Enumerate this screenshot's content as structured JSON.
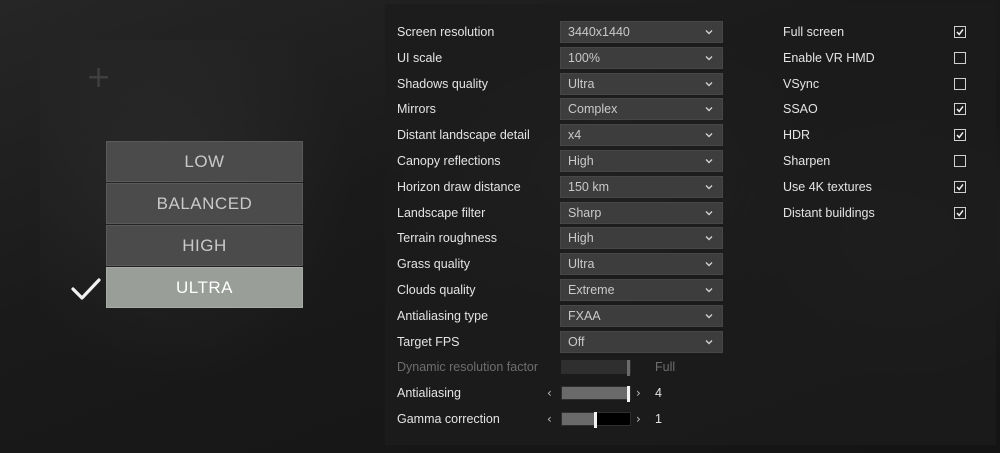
{
  "presets": {
    "items": [
      {
        "label": "LOW"
      },
      {
        "label": "BALANCED"
      },
      {
        "label": "HIGH"
      },
      {
        "label": "ULTRA"
      }
    ],
    "selected": "ULTRA",
    "check_icon": "checkmark-icon"
  },
  "settings": {
    "dropdowns": [
      {
        "label": "Screen resolution",
        "value": "3440x1440"
      },
      {
        "label": "UI scale",
        "value": "100%"
      },
      {
        "label": "Shadows quality",
        "value": "Ultra"
      },
      {
        "label": "Mirrors",
        "value": "Complex"
      },
      {
        "label": "Distant landscape detail",
        "value": "x4"
      },
      {
        "label": "Canopy reflections",
        "value": "High"
      },
      {
        "label": "Horizon draw distance",
        "value": "150 km"
      },
      {
        "label": "Landscape filter",
        "value": "Sharp"
      },
      {
        "label": "Terrain roughness",
        "value": "High"
      },
      {
        "label": "Grass quality",
        "value": "Ultra"
      },
      {
        "label": "Clouds quality",
        "value": "Extreme"
      },
      {
        "label": "Antialiasing type",
        "value": "FXAA"
      },
      {
        "label": "Target FPS",
        "value": "Off"
      }
    ],
    "sliders": [
      {
        "label": "Dynamic resolution factor",
        "value": "Full",
        "level": 1.0,
        "enabled": false
      },
      {
        "label": "Antialiasing",
        "value": "4",
        "level": 1.0,
        "enabled": true
      },
      {
        "label": "Gamma correction",
        "value": "1",
        "level": 0.5,
        "enabled": true
      }
    ],
    "slider_arrows": {
      "left": "‹",
      "right": "›"
    },
    "checkboxes": [
      {
        "label": "Full screen",
        "checked": true
      },
      {
        "label": "Enable VR HMD",
        "checked": false
      },
      {
        "label": "VSync",
        "checked": false
      },
      {
        "label": "SSAO",
        "checked": true
      },
      {
        "label": "HDR",
        "checked": true
      },
      {
        "label": "Sharpen",
        "checked": false
      },
      {
        "label": "Use 4K textures",
        "checked": true
      },
      {
        "label": "Distant buildings",
        "checked": true
      }
    ]
  },
  "colors": {
    "preset_bg": "#4b4b4b",
    "preset_selected_bg": "#9a9e99",
    "panel_bg": "#1c1c1c",
    "dropdown_bg": "#3d3d3d"
  }
}
